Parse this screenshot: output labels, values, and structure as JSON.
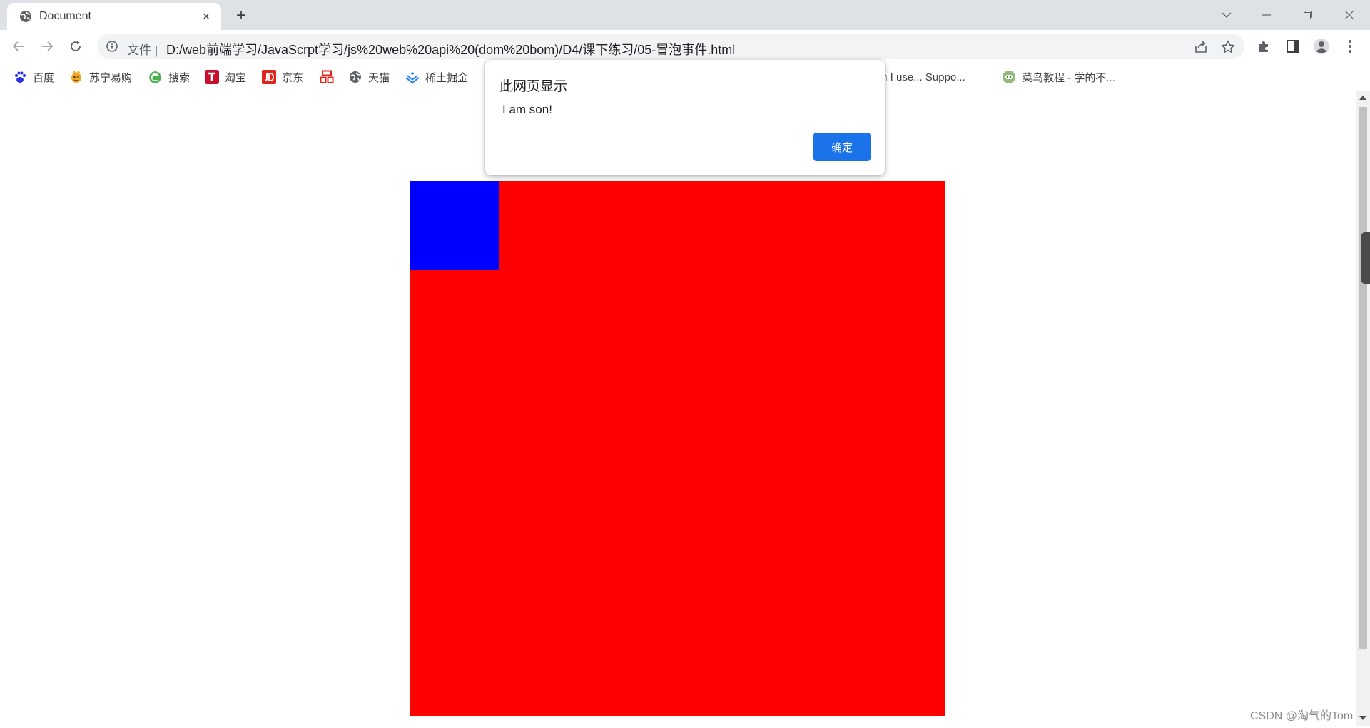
{
  "browser": {
    "tab": {
      "title": "Document",
      "close_glyph": "×",
      "favicon": "globe-icon"
    },
    "new_tab_glyph": "+",
    "window_controls": [
      "tab-search-icon",
      "minimize-icon",
      "restore-icon",
      "close-icon"
    ]
  },
  "toolbar": {
    "back": "back-arrow-icon",
    "forward": "forward-arrow-icon",
    "reload": "reload-icon",
    "omnibox": {
      "scheme_label": "文件 |",
      "url": "D:/web前端学习/JavaScrpt学习/js%20web%20api%20(dom%20bom)/D4/课下练习/05-冒泡事件.html"
    },
    "actions": [
      "share-icon",
      "bookmark-star-icon",
      "extensions-icon",
      "side-panel-icon",
      "profile-icon",
      "menu-icon"
    ]
  },
  "bookmarks": [
    {
      "label": "百度",
      "icon": "baidu-icon",
      "color": "#2932e1"
    },
    {
      "label": "苏宁易购",
      "icon": "suning-icon",
      "color": "#f5a623"
    },
    {
      "label": "搜索",
      "icon": "search-engine-icon",
      "color": "#4caf50"
    },
    {
      "label": "淘宝",
      "icon": "taobao-icon",
      "color": "#c8102e"
    },
    {
      "label": "京东",
      "icon": "jd-icon",
      "color": "#e1251b"
    },
    {
      "label": "",
      "icon": "grid-logo-icon",
      "color": "#e1251b"
    },
    {
      "label": "天猫",
      "icon": "globe-icon",
      "color": "#5f6368"
    },
    {
      "label": "稀土掘金",
      "icon": "juejin-icon",
      "color": "#1e80ff"
    },
    {
      "label": "Can I use... Suppo...",
      "icon": "caniuse-icon",
      "color": "#c4661f"
    },
    {
      "label": "菜鸟教程 - 学的不...",
      "icon": "runoob-icon",
      "color": "#96b97d"
    }
  ],
  "page": {
    "father_color": "#ff0000",
    "son_color": "#0000ff"
  },
  "dialog": {
    "title": "此网页显示",
    "message": "I am son!",
    "ok_label": "确定"
  },
  "watermark": "CSDN @淘气的Tom"
}
